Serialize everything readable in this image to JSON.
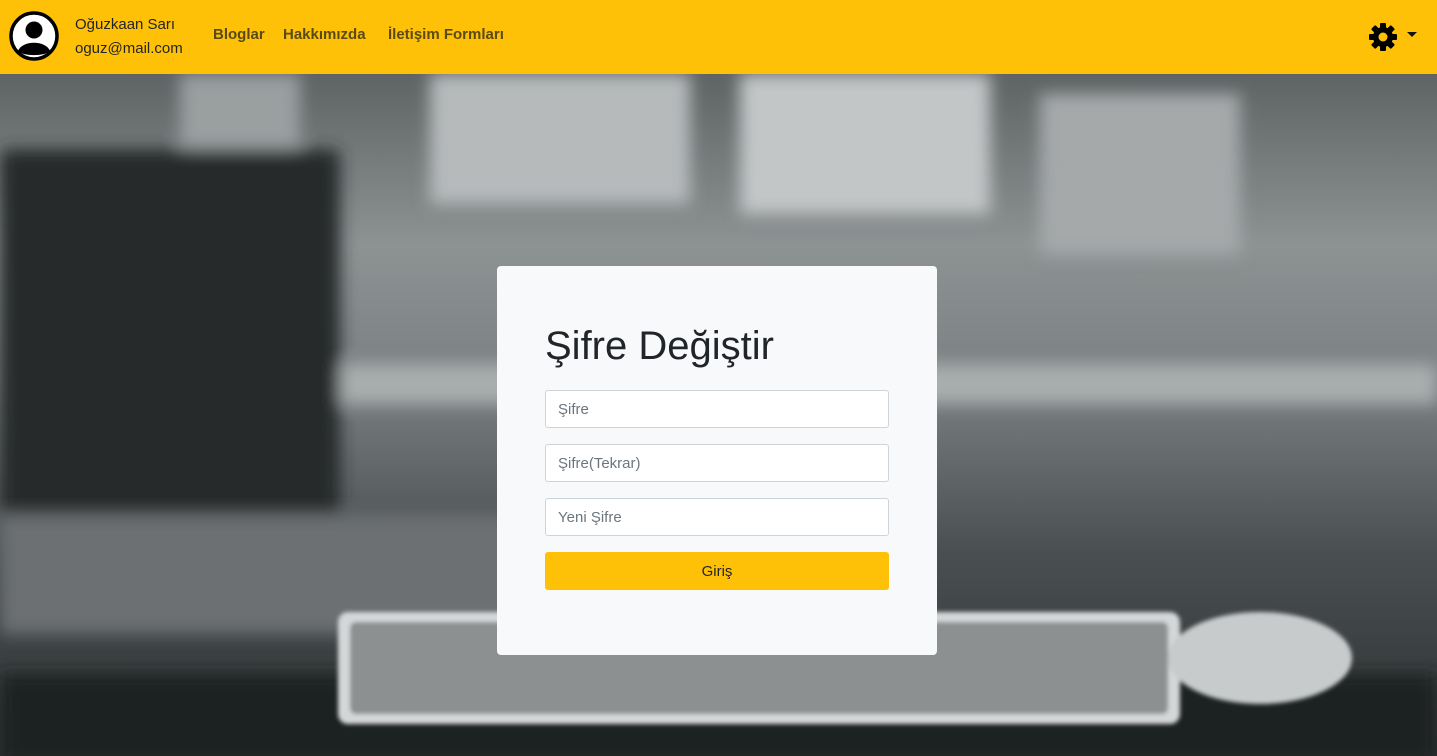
{
  "colors": {
    "navbar": "#ffc107",
    "card": "#f8f9fa",
    "button": "#ffc107"
  },
  "user": {
    "name": "Oğuzkaan Sarı",
    "email": "oguz@mail.com",
    "avatar_icon": "user-circle-icon"
  },
  "nav": {
    "links": [
      "Bloglar",
      "Hakkımızda",
      "İletişim Formları"
    ],
    "settings_icon": "gear-icon",
    "dropdown_icon": "caret-down-icon"
  },
  "form": {
    "title": "Şifre Değiştir",
    "fields": [
      {
        "placeholder": "Şifre",
        "value": ""
      },
      {
        "placeholder": "Şifre(Tekrar)",
        "value": ""
      },
      {
        "placeholder": "Yeni Şifre",
        "value": ""
      }
    ],
    "submit_label": "Giriş"
  }
}
